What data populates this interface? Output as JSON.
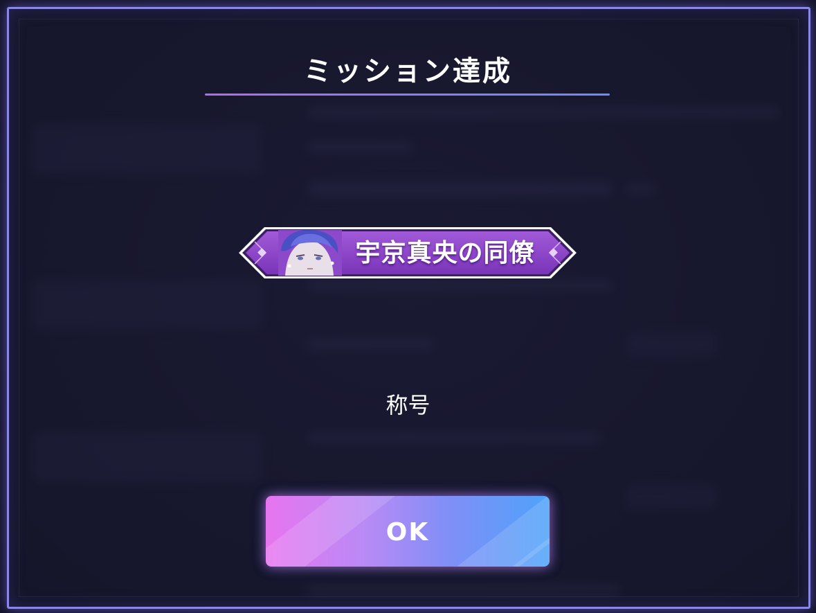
{
  "dialog": {
    "title": "ミッション達成",
    "reward": {
      "badge_label": "宇京真央の同僚",
      "portrait": "character-portrait-blue-hair",
      "type_label": "称号"
    },
    "ok_label": "OK"
  },
  "colors": {
    "frame": "#8a87e6",
    "badge_purple": "#8a3fc9",
    "button_start": "#e875f0",
    "button_end": "#4ea3fa",
    "background": "#17172e"
  }
}
